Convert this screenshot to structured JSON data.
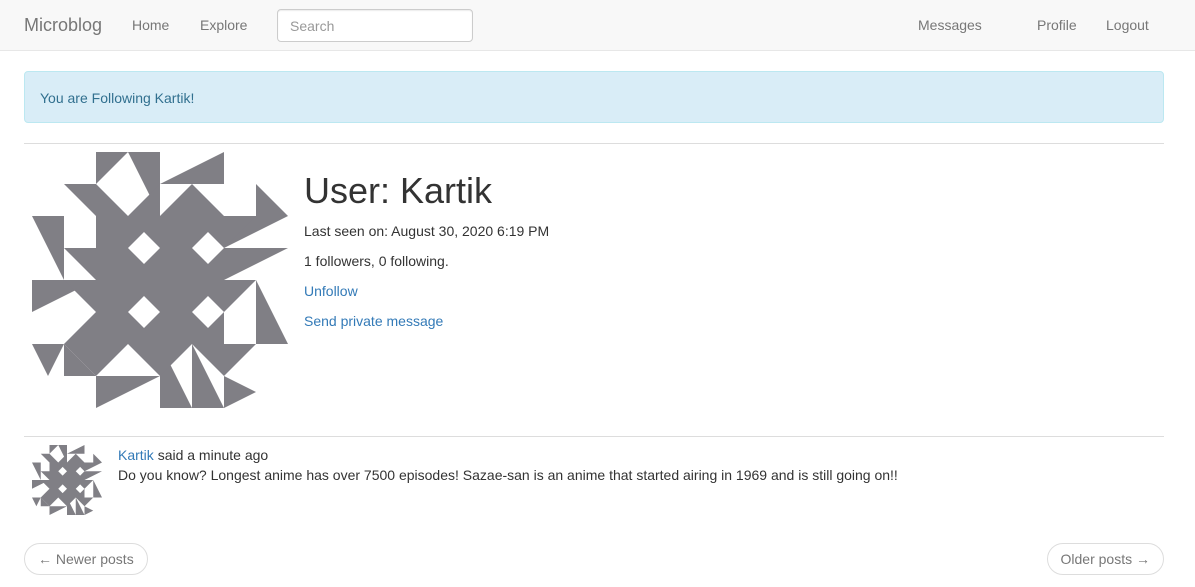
{
  "navbar": {
    "brand": "Microblog",
    "links": {
      "home": "Home",
      "explore": "Explore",
      "messages": "Messages",
      "profile": "Profile",
      "logout": "Logout"
    },
    "search": {
      "placeholder": "Search",
      "value": ""
    }
  },
  "alert": {
    "message": "You are Following Kartik!"
  },
  "profile": {
    "title": "User: Kartik",
    "last_seen": "Last seen on: August 30, 2020 6:19 PM",
    "follow_counts": "1 followers, 0 following.",
    "unfollow_label": "Unfollow",
    "send_message_label": "Send private message",
    "avatar_icon": "identicon-avatar",
    "avatar_color": "#807f85"
  },
  "posts": [
    {
      "author": "Kartik",
      "time_text": "said a minute ago",
      "body": "Do you know? Longest anime has over 7500 episodes! Sazae-san is an anime that started airing in 1969 and is still going on!!"
    }
  ],
  "pager": {
    "newer_label": "← Newer posts",
    "older_label": "Older posts →"
  },
  "colors": {
    "link": "#337ab7",
    "alert_bg": "#d9edf7",
    "alert_text": "#31708f",
    "navbar_bg": "#f8f8f8"
  }
}
